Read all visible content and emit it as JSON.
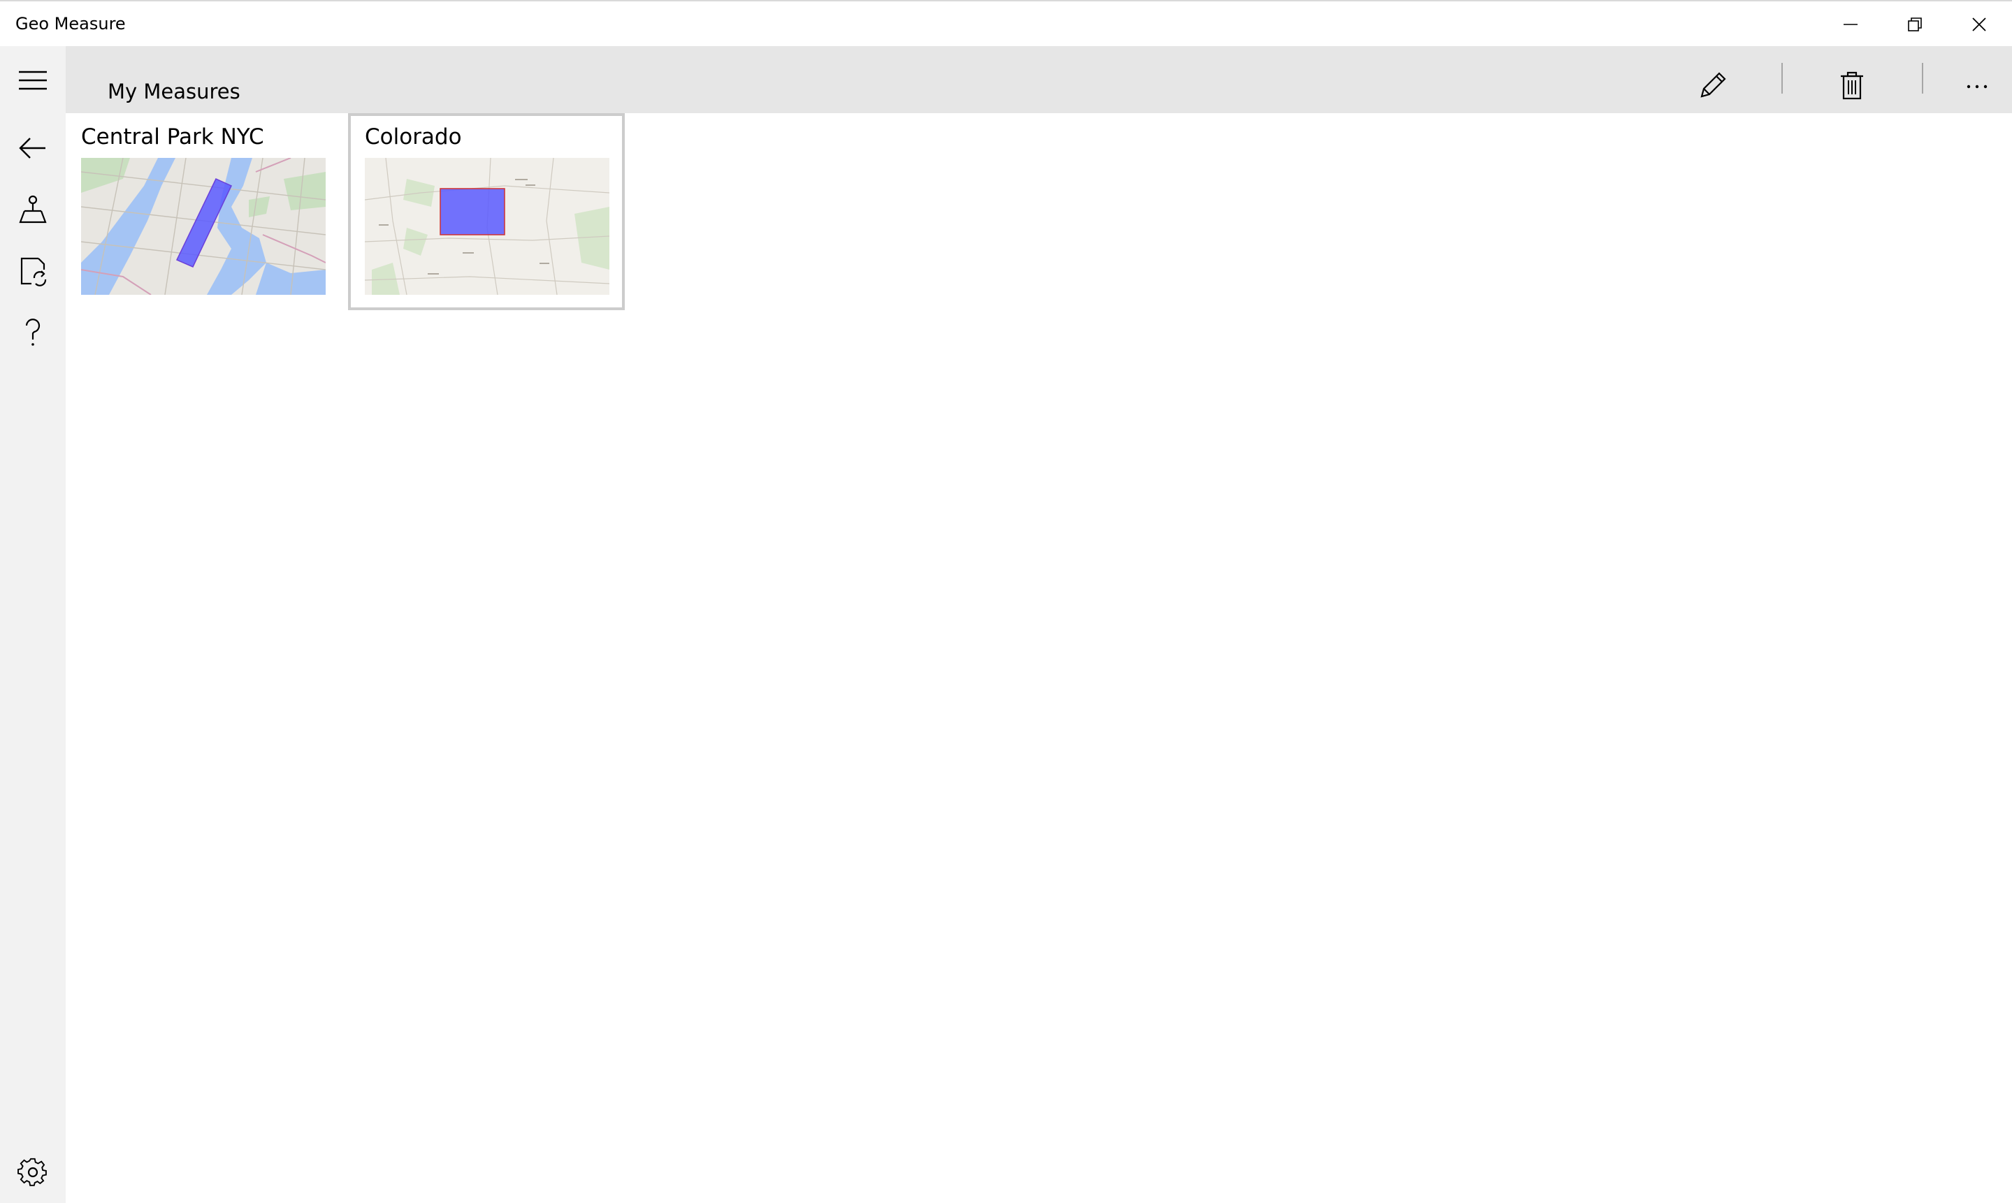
{
  "window": {
    "title": "Geo Measure",
    "controls": [
      "minimize-icon",
      "restore-icon",
      "close-icon"
    ]
  },
  "rail": {
    "items": [
      {
        "name": "hamburger-menu",
        "icon": "hamburger-icon"
      },
      {
        "name": "back",
        "icon": "back-arrow-icon"
      },
      {
        "name": "measure",
        "icon": "map-pin-icon"
      },
      {
        "name": "sync",
        "icon": "sync-document-icon"
      },
      {
        "name": "help",
        "icon": "question-icon"
      },
      {
        "name": "settings",
        "icon": "gear-icon"
      }
    ]
  },
  "commandbar": {
    "page_title": "My Measures",
    "actions": [
      "edit-icon",
      "delete-icon",
      "more-icon"
    ]
  },
  "measures": [
    {
      "title": "Central Park NYC",
      "selected": false
    },
    {
      "title": "Colorado",
      "selected": true
    }
  ],
  "colors": {
    "rail_bg": "#f2f2f2",
    "commandbar_bg": "#e6e6e6",
    "measure_fill": "#5b5bff",
    "water": "#a4c4f4",
    "selection_border": "#cccccc"
  }
}
